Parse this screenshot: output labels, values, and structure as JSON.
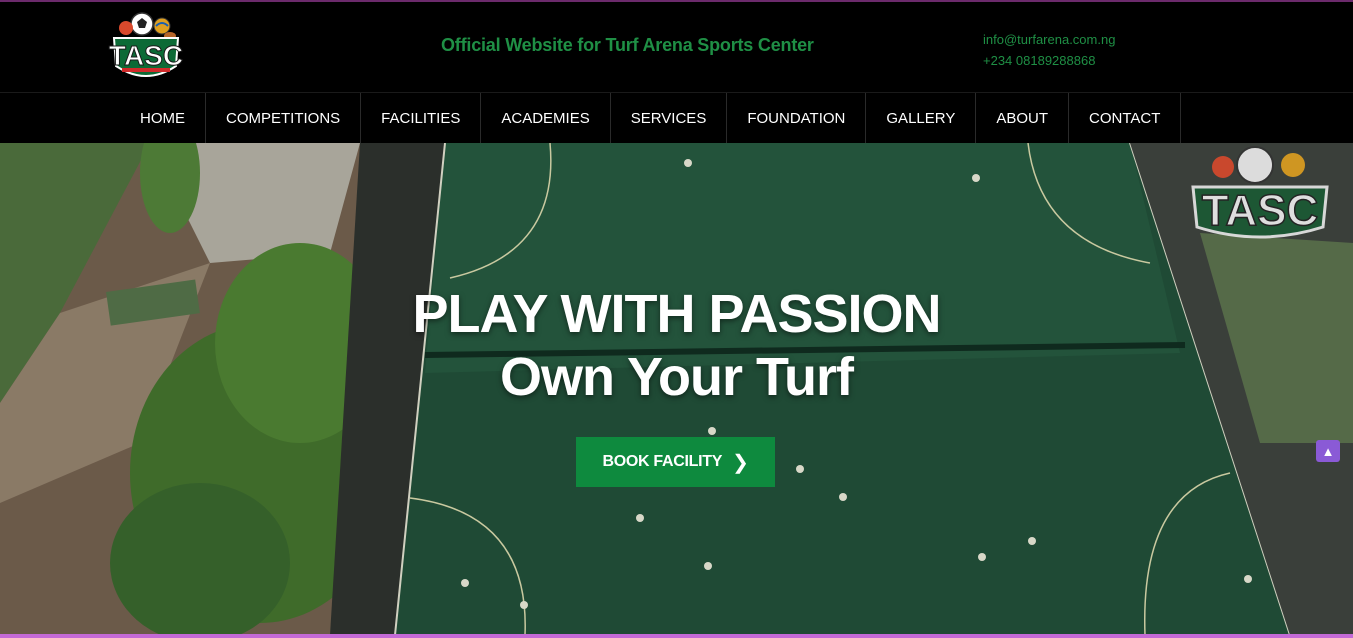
{
  "header": {
    "logo_text": "TASC",
    "tagline": "Official Website for Turf Arena Sports Center",
    "email": "info@turfarena.com.ng",
    "phone": "+234 08189288868"
  },
  "nav": {
    "items": [
      {
        "label": "HOME"
      },
      {
        "label": "COMPETITIONS"
      },
      {
        "label": "FACILITIES"
      },
      {
        "label": "ACADEMIES"
      },
      {
        "label": "SERVICES"
      },
      {
        "label": "FOUNDATION"
      },
      {
        "label": "GALLERY"
      },
      {
        "label": "ABOUT"
      },
      {
        "label": "CONTACT"
      }
    ]
  },
  "hero": {
    "title": "PLAY WITH PASSION",
    "subtitle": "Own Your Turf",
    "button_label": "BOOK FACILITY",
    "button_icon": "chevron-right-icon",
    "watermark_text": "TASC"
  },
  "colors": {
    "brand_green": "#1f8f45",
    "button_green": "#0e8a3e",
    "turf_green": "#1f4a35",
    "accent_purple": "#c46ad6"
  }
}
